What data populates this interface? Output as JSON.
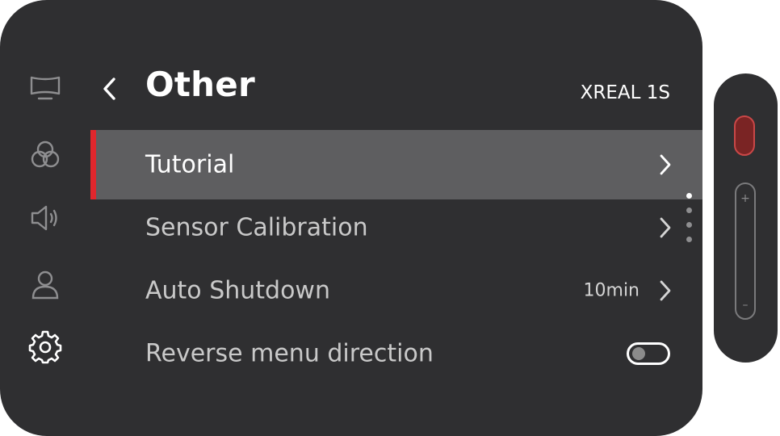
{
  "header": {
    "back_icon": "chevron-left-icon",
    "title": "Other",
    "device_name": "XREAL 1S"
  },
  "sidebar": {
    "items": [
      {
        "name": "display",
        "icon": "display-icon",
        "active": false
      },
      {
        "name": "color",
        "icon": "color-circles-icon",
        "active": false
      },
      {
        "name": "sound",
        "icon": "speaker-icon",
        "active": false
      },
      {
        "name": "user",
        "icon": "user-icon",
        "active": false
      },
      {
        "name": "settings",
        "icon": "gear-icon",
        "active": true
      }
    ]
  },
  "menu": {
    "items": [
      {
        "label": "Tutorial",
        "value": "",
        "control": "chevron",
        "selected": true
      },
      {
        "label": "Sensor Calibration",
        "value": "",
        "control": "chevron",
        "selected": false
      },
      {
        "label": "Auto Shutdown",
        "value": "10min",
        "control": "chevron",
        "selected": false
      },
      {
        "label": "Reverse menu direction",
        "value": "",
        "control": "toggle",
        "toggle_on": false,
        "selected": false
      }
    ]
  },
  "pagination": {
    "total": 4,
    "current": 1
  },
  "remote": {
    "plus_symbol": "+",
    "minus_symbol": "–"
  },
  "colors": {
    "panel": "#2f2f31",
    "selected_row": "#5e5e60",
    "accent": "#e0272d",
    "text_primary": "#ffffff",
    "text_secondary": "#c9c9c9"
  }
}
